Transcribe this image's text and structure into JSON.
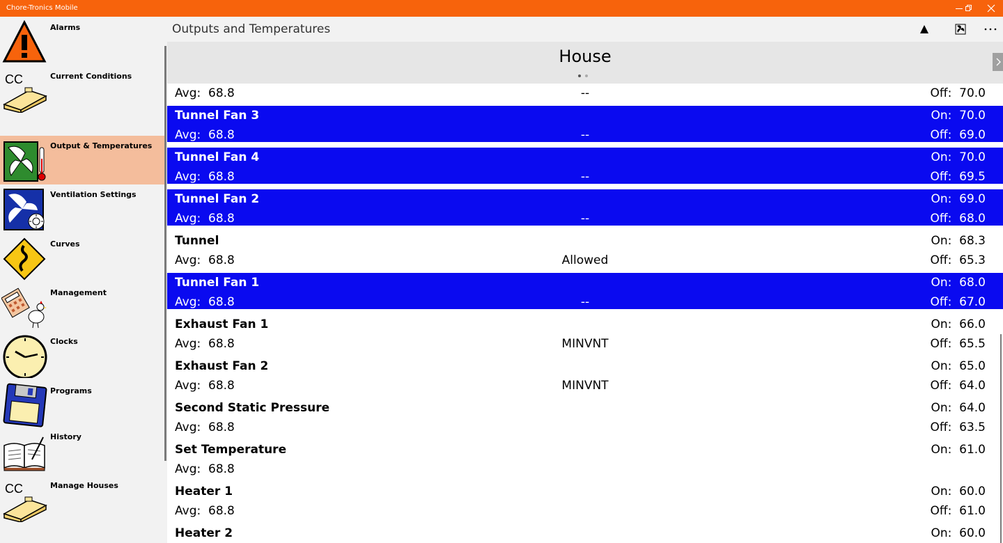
{
  "window": {
    "title": "Chore-Tronics Mobile",
    "accent": "#f7630c"
  },
  "sidebar": {
    "items": [
      {
        "label": "Alarms",
        "icon": "warning-icon"
      },
      {
        "label": "Current Conditions",
        "icon": "house-cc-icon"
      },
      {
        "label": "Output & Temperatures",
        "icon": "fan-thermometer-icon",
        "active": true
      },
      {
        "label": "Ventilation Settings",
        "icon": "fan-sun-icon"
      },
      {
        "label": "Curves",
        "icon": "curve-sign-icon"
      },
      {
        "label": "Management",
        "icon": "calculator-chicken-icon"
      },
      {
        "label": "Clocks",
        "icon": "clock-icon"
      },
      {
        "label": "Programs",
        "icon": "floppy-disk-icon"
      },
      {
        "label": "History",
        "icon": "book-icon"
      },
      {
        "label": "Manage Houses",
        "icon": "house-cc-icon"
      }
    ],
    "active_color": "#f4bd9c"
  },
  "header": {
    "title": "Outputs and Temperatures",
    "commands": [
      "up-arrow-icon",
      "fan-icon",
      "more-icon"
    ]
  },
  "pivot": {
    "title": "House",
    "page_count": 2,
    "current_page": 1
  },
  "rows": [
    {
      "name": "",
      "avg": "Avg:  68.8",
      "status": "--",
      "on": "",
      "off": "Off:  70.0",
      "highlight": false
    },
    {
      "name": "Tunnel Fan 3",
      "avg": "Avg:  68.8",
      "status": "--",
      "on": "On:  70.0",
      "off": "Off:  69.0",
      "highlight": true
    },
    {
      "name": "Tunnel Fan 4",
      "avg": "Avg:  68.8",
      "status": "--",
      "on": "On:  70.0",
      "off": "Off:  69.5",
      "highlight": true
    },
    {
      "name": "Tunnel Fan 2",
      "avg": "Avg:  68.8",
      "status": "--",
      "on": "On:  69.0",
      "off": "Off:  68.0",
      "highlight": true
    },
    {
      "name": "Tunnel",
      "avg": "Avg:  68.8",
      "status": "Allowed",
      "on": "On:  68.3",
      "off": "Off:  65.3",
      "highlight": false
    },
    {
      "name": "Tunnel Fan 1",
      "avg": "Avg:  68.8",
      "status": "--",
      "on": "On:  68.0",
      "off": "Off:  67.0",
      "highlight": true
    },
    {
      "name": "Exhaust Fan 1",
      "avg": "Avg:  68.8",
      "status": "MINVNT",
      "on": "On:  66.0",
      "off": "Off:  65.5",
      "highlight": false
    },
    {
      "name": "Exhaust Fan 2",
      "avg": "Avg:  68.8",
      "status": "MINVNT",
      "on": "On:  65.0",
      "off": "Off:  64.0",
      "highlight": false
    },
    {
      "name": "Second Static Pressure",
      "avg": "Avg:  68.8",
      "status": "",
      "on": "On:  64.0",
      "off": "Off:  63.5",
      "highlight": false
    },
    {
      "name": "Set Temperature",
      "avg": "Avg:  68.8",
      "status": "",
      "on": "On:  61.0",
      "off": "",
      "highlight": false
    },
    {
      "name": "Heater 1",
      "avg": "Avg:  68.8",
      "status": "",
      "on": "On:  60.0",
      "off": "Off:  61.0",
      "highlight": false
    },
    {
      "name": "Heater 2",
      "avg": "",
      "status": "",
      "on": "On:  60.0",
      "off": "",
      "highlight": false
    }
  ],
  "colors": {
    "row_highlight": "#0a0af0"
  }
}
